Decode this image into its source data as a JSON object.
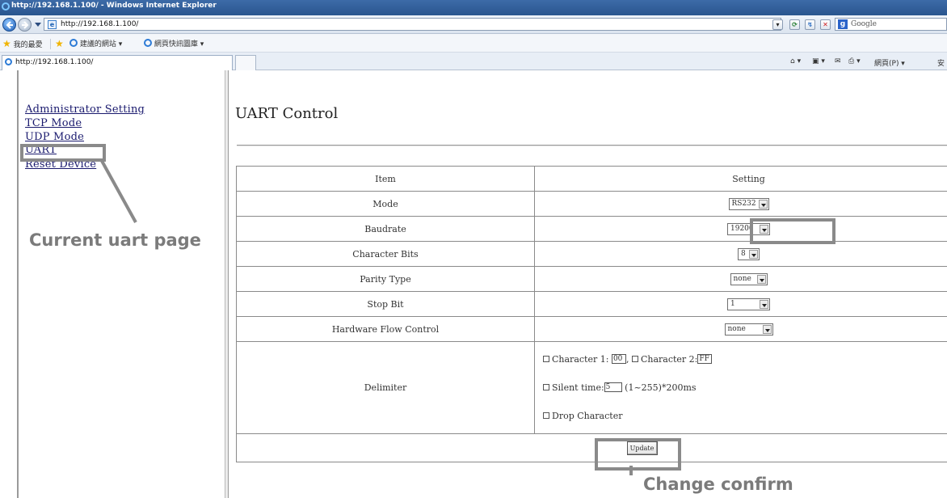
{
  "window": {
    "title": "http://192.168.1.100/ - Windows Internet Explorer"
  },
  "address": {
    "url": "http://192.168.1.100/",
    "search_engine": "Google"
  },
  "favorites": {
    "favorites_label": "我的最愛",
    "suggested_sites": "建議的網站 ▾",
    "web_slice": "網頁快訊圖庫 ▾"
  },
  "tab": {
    "label": "http://192.168.1.100/"
  },
  "command_bar": {
    "page_menu": "網頁(P) ▾",
    "safety_menu": "安"
  },
  "sidebar": {
    "items": [
      {
        "label": "Administrator Setting"
      },
      {
        "label": "TCP Mode"
      },
      {
        "label": "UDP Mode"
      },
      {
        "label": "UART"
      },
      {
        "label": "Reset Device"
      }
    ]
  },
  "page": {
    "title": "UART Control"
  },
  "table": {
    "header": {
      "item": "Item",
      "setting": "Setting"
    },
    "rows": [
      {
        "item": "Mode",
        "value": "RS232"
      },
      {
        "item": "Baudrate",
        "value": "19200"
      },
      {
        "item": "Character Bits",
        "value": "8"
      },
      {
        "item": "Parity Type",
        "value": "none"
      },
      {
        "item": "Stop Bit",
        "value": "1"
      },
      {
        "item": "Hardware Flow Control",
        "value": "none"
      }
    ],
    "delimiter": {
      "label": "Delimiter",
      "char1_label": "Character 1:",
      "char1_value": "00",
      "separator": ",",
      "char2_label": "Character 2:",
      "char2_value": "FF",
      "silent_label": "Silent time:",
      "silent_value": "5",
      "silent_suffix": "(1~255)*200ms",
      "drop_label": "Drop Character"
    },
    "update_label": "Update"
  },
  "annotations": {
    "current_page": "Current uart page",
    "change_confirm": "Change confirm",
    "color": "#8a8a8a"
  }
}
